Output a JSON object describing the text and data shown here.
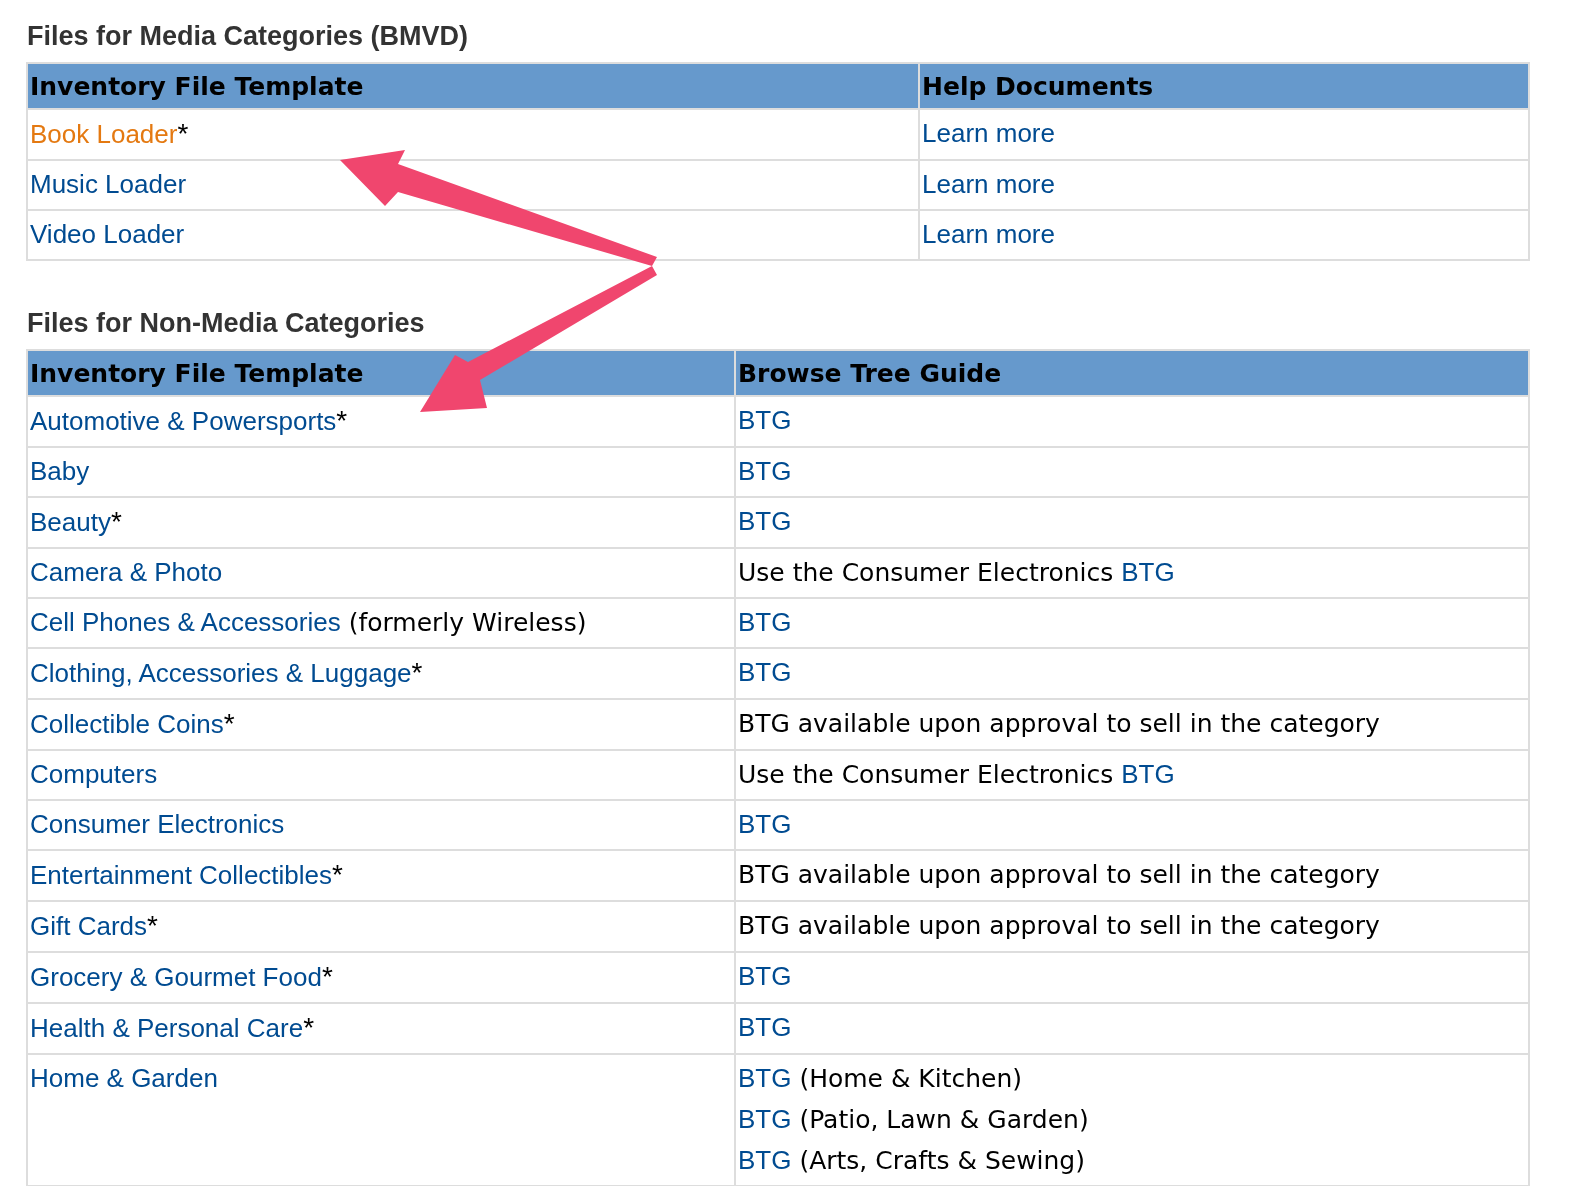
{
  "sections": [
    {
      "title": "Files for Media Categories (BMVD)",
      "columns": [
        "Inventory File Template",
        "Help Documents"
      ],
      "rows": [
        [
          [
            [
              {
                "kind": "visited-link",
                "text": "Book Loader"
              },
              {
                "kind": "text",
                "text": "*"
              }
            ]
          ],
          [
            [
              {
                "kind": "link",
                "text": "Learn more"
              }
            ]
          ]
        ],
        [
          [
            [
              {
                "kind": "link",
                "text": "Music Loader"
              }
            ]
          ],
          [
            [
              {
                "kind": "link",
                "text": "Learn more"
              }
            ]
          ]
        ],
        [
          [
            [
              {
                "kind": "link",
                "text": "Video Loader"
              }
            ]
          ],
          [
            [
              {
                "kind": "link",
                "text": "Learn more"
              }
            ]
          ]
        ]
      ]
    },
    {
      "title": "Files for Non-Media Categories",
      "columns": [
        "Inventory File Template",
        "Browse Tree Guide"
      ],
      "rows": [
        [
          [
            [
              {
                "kind": "link",
                "text": "Automotive & Powersports"
              },
              {
                "kind": "text",
                "text": "*"
              }
            ]
          ],
          [
            [
              {
                "kind": "link",
                "text": "BTG"
              }
            ]
          ]
        ],
        [
          [
            [
              {
                "kind": "link",
                "text": "Baby"
              }
            ]
          ],
          [
            [
              {
                "kind": "link",
                "text": "BTG"
              }
            ]
          ]
        ],
        [
          [
            [
              {
                "kind": "link",
                "text": "Beauty"
              },
              {
                "kind": "text",
                "text": "*"
              }
            ]
          ],
          [
            [
              {
                "kind": "link",
                "text": "BTG"
              }
            ]
          ]
        ],
        [
          [
            [
              {
                "kind": "link",
                "text": "Camera & Photo"
              }
            ]
          ],
          [
            [
              {
                "kind": "text",
                "text": "Use the Consumer Electronics "
              },
              {
                "kind": "link",
                "text": "BTG"
              }
            ]
          ]
        ],
        [
          [
            [
              {
                "kind": "link",
                "text": "Cell Phones & Accessories"
              },
              {
                "kind": "text",
                "text": " (formerly Wireless)"
              }
            ]
          ],
          [
            [
              {
                "kind": "link",
                "text": "BTG"
              }
            ]
          ]
        ],
        [
          [
            [
              {
                "kind": "link",
                "text": "Clothing, Accessories & Luggage"
              },
              {
                "kind": "text",
                "text": "*"
              }
            ]
          ],
          [
            [
              {
                "kind": "link",
                "text": "BTG"
              }
            ]
          ]
        ],
        [
          [
            [
              {
                "kind": "link",
                "text": "Collectible Coins"
              },
              {
                "kind": "text",
                "text": "*"
              }
            ]
          ],
          [
            [
              {
                "kind": "text",
                "text": "BTG available upon approval to sell in the category"
              }
            ]
          ]
        ],
        [
          [
            [
              {
                "kind": "link",
                "text": "Computers"
              }
            ]
          ],
          [
            [
              {
                "kind": "text",
                "text": "Use the Consumer Electronics "
              },
              {
                "kind": "link",
                "text": "BTG"
              }
            ]
          ]
        ],
        [
          [
            [
              {
                "kind": "link",
                "text": "Consumer Electronics"
              }
            ]
          ],
          [
            [
              {
                "kind": "link",
                "text": "BTG"
              }
            ]
          ]
        ],
        [
          [
            [
              {
                "kind": "link",
                "text": "Entertainment Collectibles"
              },
              {
                "kind": "text",
                "text": "*"
              }
            ]
          ],
          [
            [
              {
                "kind": "text",
                "text": "BTG available upon approval to sell in the category"
              }
            ]
          ]
        ],
        [
          [
            [
              {
                "kind": "link",
                "text": "Gift Cards"
              },
              {
                "kind": "text",
                "text": "*"
              }
            ]
          ],
          [
            [
              {
                "kind": "text",
                "text": "BTG available upon approval to sell in the category"
              }
            ]
          ]
        ],
        [
          [
            [
              {
                "kind": "link",
                "text": "Grocery & Gourmet Food"
              },
              {
                "kind": "text",
                "text": "*"
              }
            ]
          ],
          [
            [
              {
                "kind": "link",
                "text": "BTG"
              }
            ]
          ]
        ],
        [
          [
            [
              {
                "kind": "link",
                "text": "Health & Personal Care"
              },
              {
                "kind": "text",
                "text": "*"
              }
            ]
          ],
          [
            [
              {
                "kind": "link",
                "text": "BTG"
              }
            ]
          ]
        ],
        [
          [
            [
              {
                "kind": "link",
                "text": "Home & Garden"
              }
            ]
          ],
          [
            [
              {
                "kind": "link",
                "text": "BTG"
              },
              {
                "kind": "text",
                "text": " (Home & Kitchen)"
              }
            ],
            [
              {
                "kind": "link",
                "text": "BTG"
              },
              {
                "kind": "text",
                "text": " (Patio, Lawn & Garden)"
              }
            ],
            [
              {
                "kind": "link",
                "text": "BTG"
              },
              {
                "kind": "text",
                "text": " (Arts, Crafts & Sewing)"
              }
            ]
          ]
        ]
      ]
    }
  ]
}
